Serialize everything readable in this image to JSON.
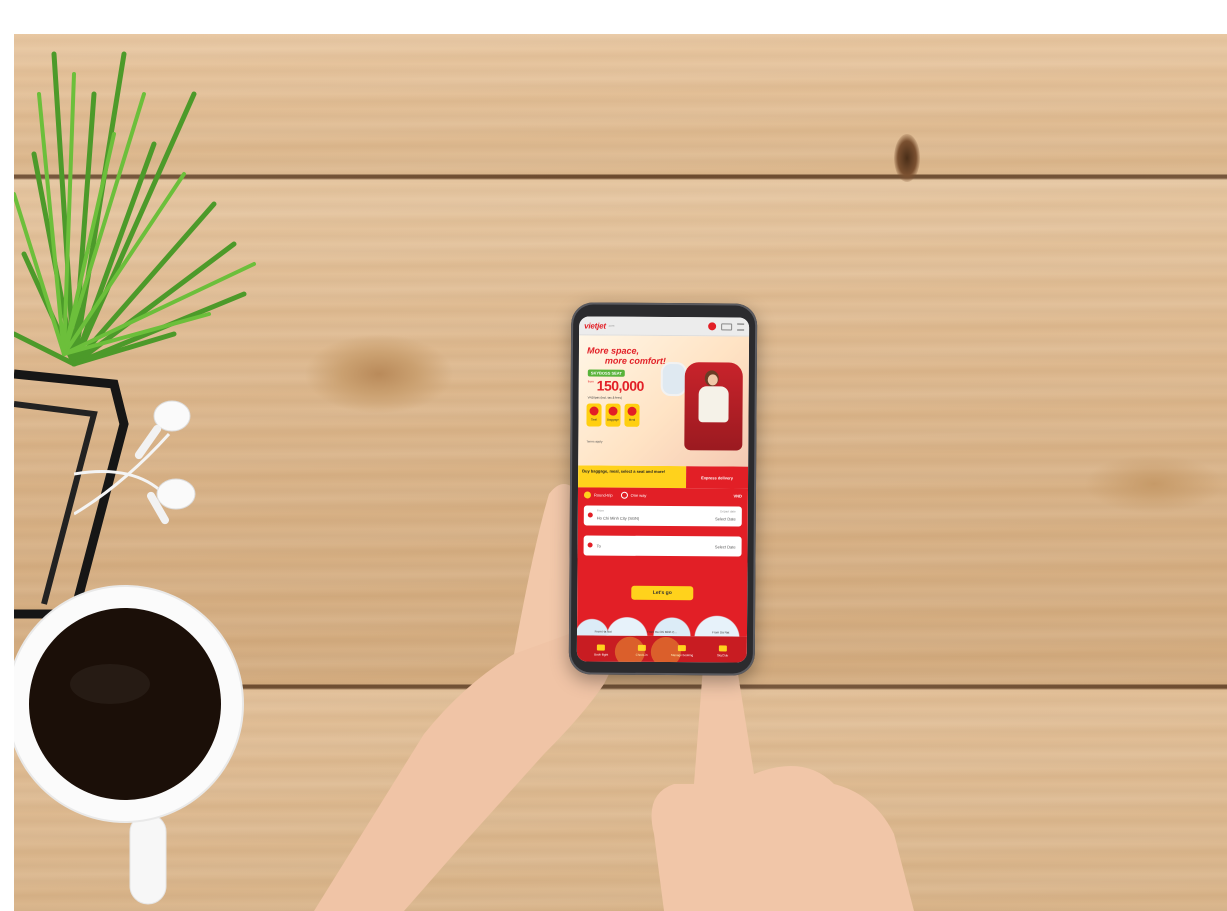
{
  "app": {
    "logo": "vietjet",
    "logo_sub": ".com",
    "currency": "VND"
  },
  "banner": {
    "headline_line1": "More space,",
    "headline_line2": "more comfort!",
    "tag": "SKYBOSS SEAT",
    "price_from": "from",
    "price": "150,000",
    "price_note": "VND/pax (incl. tax & fees)",
    "badges": [
      "Seat",
      "Baggage",
      "Meal"
    ],
    "footnote": "Terms apply"
  },
  "promo": {
    "left_text": "Buy baggage, meal, select a seat and more!",
    "right_text": "Express delivery"
  },
  "booking": {
    "round_trip": "Round-trip",
    "one_way": "One way",
    "from_label": "From",
    "from_value": "Ho Chi Minh City (SGN)",
    "depart_label": "Depart date",
    "depart_value": "Select Date",
    "to_value": "To",
    "return_value": "Select Date",
    "go_label": "Let's go"
  },
  "routes": [
    "From Ha Noi",
    "From Ho Chi Minh C...",
    "From Da Nat"
  ],
  "nav": [
    "Book flight",
    "Check-in",
    "Manage booking",
    "SkyClub"
  ],
  "colors": {
    "brand_red": "#e21f26",
    "brand_yellow": "#ffd21c",
    "skyboss_green": "#58b33a",
    "wood": "#dcb78c"
  }
}
